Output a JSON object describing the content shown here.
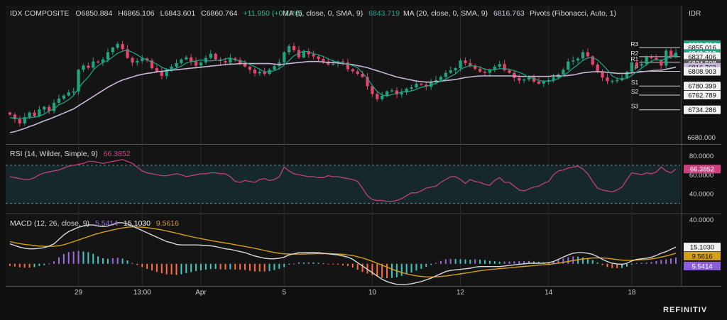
{
  "colors": {
    "up": "#22a37f",
    "down": "#e4456a",
    "ma5": "#1ea68a",
    "ma20": "#c7b6d8",
    "rsi": "#c0407a",
    "signal": "#d4a017",
    "macd": "#d8d8d8",
    "hist_up": "#9b6de0",
    "hist_down": "#ff6f3c",
    "hist_teal": "#3fc9c1",
    "panel": "#131313",
    "grid": "#2a2a2a"
  },
  "brand": "REFINITIV",
  "axis_currency": "IDR",
  "chart_data": [
    {
      "type": "candlestick",
      "legend": {
        "name": "IDX COMPOSITE",
        "open_label": "O",
        "open": "6850.884",
        "high_label": "H",
        "high": "6865.106",
        "low_label": "L",
        "low": "6843.601",
        "close_label": "C",
        "close": "6860.764",
        "change": "+11.950 (+0.17%)",
        "ma5_label": "MA (5, close, 0, SMA, 9)",
        "ma5_value": "6843.719",
        "ma20_label": "MA (20, close, 0, SMA, 9)",
        "ma20_value": "6816.763",
        "pivots_label": "Pivots (Fibonacci, Auto, 1)"
      },
      "y_range": [
        6672,
        6906
      ],
      "x_ticks": [
        {
          "i": 14,
          "label": "29"
        },
        {
          "i": 27,
          "label": "13:00"
        },
        {
          "i": 39,
          "label": "Apr"
        },
        {
          "i": 56,
          "label": "5"
        },
        {
          "i": 74,
          "label": "10"
        },
        {
          "i": 92,
          "label": "12"
        },
        {
          "i": 110,
          "label": "14"
        },
        {
          "i": 127,
          "label": "18"
        }
      ],
      "y_tick": "6680.000",
      "price_tags": [
        {
          "value": 6860.764,
          "label": "6860.764",
          "kind": "last"
        },
        {
          "value": 6855.016,
          "label": "6855.016",
          "kind": "plain"
        },
        {
          "value": 6843.719,
          "label": "6843.719",
          "kind": "ma5"
        },
        {
          "value": 6837.406,
          "label": "6837.406",
          "kind": "plain"
        },
        {
          "value": 6824.508,
          "label": "6824.508",
          "kind": "grey"
        },
        {
          "value": 6816.763,
          "label": "6816.763",
          "kind": "ma20"
        },
        {
          "value": 6808.903,
          "label": "6808.903",
          "kind": "plain"
        },
        {
          "value": 6780.399,
          "label": "6780.399",
          "kind": "plain"
        },
        {
          "value": 6762.789,
          "label": "6762.789",
          "kind": "plain"
        },
        {
          "value": 6734.286,
          "label": "6734.286",
          "kind": "plain"
        }
      ],
      "pivots": [
        {
          "label": "R3",
          "value": 6855.016
        },
        {
          "label": "R2",
          "value": 6837.406
        },
        {
          "label": "R1",
          "value": 6826.5
        },
        {
          "label": "P",
          "value": 6808.903
        },
        {
          "label": "S1",
          "value": 6780.399
        },
        {
          "label": "S2",
          "value": 6762.789
        },
        {
          "label": "S3",
          "value": 6734.286
        }
      ],
      "closes": [
        6725,
        6716,
        6708,
        6720,
        6729,
        6722,
        6735,
        6740,
        6732,
        6748,
        6756,
        6762,
        6768,
        6770,
        6812,
        6820,
        6816,
        6828,
        6826,
        6832,
        6846,
        6855,
        6862,
        6852,
        6835,
        6826,
        6829,
        6834,
        6830,
        6815,
        6808,
        6800,
        6812,
        6818,
        6825,
        6832,
        6836,
        6828,
        6820,
        6826,
        6835,
        6843,
        6832,
        6829,
        6826,
        6834,
        6831,
        6824,
        6818,
        6812,
        6805,
        6808,
        6804,
        6812,
        6819,
        6826,
        6846,
        6858,
        6850,
        6836,
        6848,
        6842,
        6838,
        6833,
        6828,
        6822,
        6824,
        6828,
        6826,
        6813,
        6809,
        6804,
        6798,
        6780,
        6765,
        6755,
        6762,
        6770,
        6772,
        6764,
        6768,
        6775,
        6778,
        6785,
        6783,
        6779,
        6788,
        6792,
        6798,
        6806,
        6811,
        6815,
        6830,
        6825,
        6820,
        6814,
        6808,
        6806,
        6812,
        6818,
        6823,
        6811,
        6806,
        6796,
        6791,
        6793,
        6797,
        6789,
        6785,
        6789,
        6792,
        6797,
        6803,
        6812,
        6828,
        6830,
        6834,
        6846,
        6838,
        6822,
        6807,
        6797,
        6790,
        6790,
        6792,
        6796,
        6808,
        6826,
        6820,
        6823,
        6837,
        6835,
        6831,
        6820,
        6849,
        6838,
        6845
      ],
      "ma5": [
        6719,
        6718,
        6717,
        6718,
        6719,
        6720,
        6722,
        6726,
        6732,
        6736,
        6744,
        6748,
        6754,
        6762,
        6776,
        6788,
        6798,
        6811,
        6820,
        6826,
        6830,
        6837,
        6844,
        6848,
        6850,
        6846,
        6841,
        6835,
        6831,
        6827,
        6823,
        6817,
        6813,
        6812,
        6815,
        6819,
        6825,
        6828,
        6829,
        6831,
        6830,
        6829,
        6830,
        6830,
        6833,
        6835,
        6831,
        6829,
        6827,
        6822,
        6818,
        6813,
        6808,
        6808,
        6810,
        6814,
        6821,
        6830,
        6839,
        6844,
        6848,
        6847,
        6843,
        6841,
        6838,
        6833,
        6829,
        6827,
        6825,
        6823,
        6820,
        6816,
        6806,
        6795,
        6781,
        6770,
        6763,
        6761,
        6764,
        6766,
        6769,
        6770,
        6771,
        6774,
        6778,
        6780,
        6782,
        6786,
        6790,
        6794,
        6799,
        6804,
        6813,
        6817,
        6820,
        6819,
        6817,
        6813,
        6812,
        6812,
        6814,
        6814,
        6813,
        6810,
        6807,
        6803,
        6797,
        6795,
        6791,
        6790,
        6790,
        6791,
        6795,
        6801,
        6807,
        6815,
        6822,
        6830,
        6835,
        6836,
        6831,
        6822,
        6812,
        6800,
        6795,
        6794,
        6795,
        6801,
        6808,
        6815,
        6822,
        6829,
        6832,
        6830,
        6834,
        6836,
        6844
      ],
      "ma20": [
        6690,
        6692,
        6695,
        6698,
        6702,
        6705,
        6709,
        6713,
        6716,
        6720,
        6724,
        6728,
        6732,
        6736,
        6742,
        6748,
        6754,
        6760,
        6766,
        6772,
        6778,
        6783,
        6788,
        6792,
        6795,
        6798,
        6801,
        6803,
        6805,
        6806,
        6808,
        6809,
        6810,
        6811,
        6812,
        6813,
        6814,
        6815,
        6816,
        6817,
        6818,
        6819,
        6820,
        6821,
        6822,
        6823,
        6823,
        6824,
        6824,
        6824,
        6824,
        6824,
        6824,
        6824,
        6823,
        6822,
        6823,
        6824,
        6825,
        6826,
        6827,
        6828,
        6828,
        6828,
        6827,
        6826,
        6826,
        6825,
        6824,
        6823,
        6822,
        6820,
        6818,
        6816,
        6813,
        6810,
        6807,
        6804,
        6801,
        6798,
        6796,
        6794,
        6792,
        6790,
        6789,
        6788,
        6788,
        6789,
        6790,
        6791,
        6792,
        6793,
        6795,
        6797,
        6798,
        6799,
        6800,
        6800,
        6800,
        6800,
        6800,
        6800,
        6800,
        6800,
        6799,
        6799,
        6799,
        6799,
        6799,
        6799,
        6799,
        6800,
        6800,
        6800,
        6801,
        6802,
        6804,
        6806,
        6807,
        6808,
        6808,
        6808,
        6807,
        6806,
        6805,
        6805,
        6805,
        6806,
        6807,
        6808,
        6809,
        6810,
        6811,
        6811,
        6813,
        6815,
        6817
      ]
    },
    {
      "type": "line",
      "name": "rsi",
      "legend": {
        "label": "RSI (14, Wilder, Simple, 9)",
        "value": "66.3852"
      },
      "y_range": [
        20,
        90
      ],
      "ticks": [
        {
          "value": 80,
          "label": "80.0000"
        },
        {
          "value": 60,
          "label": "60.0000"
        },
        {
          "value": 40,
          "label": "40.0000"
        }
      ],
      "band": [
        30,
        70
      ],
      "last_tag": "66.3852",
      "values": [
        58,
        57,
        56,
        55,
        55,
        57,
        60,
        62,
        63,
        64,
        65,
        67,
        69,
        70,
        71,
        72,
        74,
        74,
        73,
        72,
        73,
        74,
        75,
        76,
        74,
        72,
        68,
        64,
        62,
        61,
        60,
        59,
        59,
        60,
        61,
        60,
        58,
        59,
        60,
        61,
        61,
        62,
        62,
        61,
        61,
        58,
        53,
        52,
        54,
        53,
        52,
        55,
        56,
        54,
        55,
        58,
        68,
        64,
        61,
        60,
        59,
        58,
        58,
        57,
        57,
        59,
        58,
        58,
        57,
        56,
        55,
        53,
        46,
        38,
        34,
        33,
        33,
        32,
        32,
        33,
        35,
        38,
        41,
        41,
        43,
        46,
        47,
        48,
        52,
        55,
        58,
        58,
        55,
        51,
        55,
        53,
        52,
        50,
        49,
        54,
        57,
        52,
        52,
        48,
        44,
        43,
        45,
        47,
        48,
        51,
        53,
        60,
        64,
        65,
        67,
        68,
        69,
        66,
        61,
        53,
        46,
        44,
        43,
        42,
        44,
        47,
        55,
        62,
        61,
        60,
        62,
        61,
        63,
        68,
        64,
        62,
        66
      ]
    },
    {
      "type": "line",
      "name": "macd",
      "legend": {
        "label": "MACD (12, 26, close, 9)",
        "hist": "5.5414",
        "macd": "15.1030",
        "signal": "9.5616"
      },
      "y_range": [
        -20,
        44
      ],
      "ticks": [
        {
          "value": 40,
          "label": "40.0000"
        },
        {
          "value": 0,
          "label": "0.0000"
        }
      ],
      "tags": [
        {
          "label": "15.1030",
          "kind": "macd"
        },
        {
          "label": "9.5616",
          "kind": "signal"
        },
        {
          "label": "5.5414",
          "kind": "hist"
        }
      ],
      "macd": [
        18,
        16.5,
        15,
        14,
        13.5,
        13.5,
        14,
        14.5,
        16,
        18,
        22,
        26,
        29,
        31,
        33,
        34,
        35,
        35,
        34,
        33.5,
        34,
        35.5,
        37,
        37,
        36,
        34,
        32,
        30,
        28,
        26,
        24,
        22,
        20,
        19,
        17.5,
        17,
        17,
        17,
        17,
        16.8,
        16.5,
        16.2,
        15.5,
        14.5,
        13.5,
        13,
        12,
        11,
        10,
        8.5,
        7,
        6,
        5,
        4.5,
        4.5,
        5,
        6,
        8,
        9,
        10,
        10,
        10.2,
        10.2,
        10,
        9.5,
        9,
        8.5,
        8,
        7,
        6,
        4,
        1,
        -2,
        -5,
        -8,
        -11,
        -14,
        -16,
        -17.5,
        -18.5,
        -18.8,
        -18.5,
        -18,
        -17,
        -16,
        -14.5,
        -13,
        -11,
        -9,
        -7,
        -6,
        -5.5,
        -5,
        -4.5,
        -4,
        -3,
        -2.5,
        -2.5,
        -2.5,
        -2.5,
        -2.5,
        -2,
        -1.5,
        -1,
        -0.5,
        0,
        0.5,
        0.5,
        0.5,
        0.5,
        1,
        2,
        4,
        6,
        8,
        9.5,
        10,
        10,
        9.5,
        8.5,
        6.5,
        4,
        2,
        0.5,
        -0.2,
        -0.5,
        0.5,
        2.5,
        4,
        4.5,
        5,
        6,
        7.5,
        9.5,
        11,
        13,
        15.1
      ],
      "signal": [
        20,
        19,
        18.2,
        17.5,
        17,
        16.5,
        16,
        15.8,
        15.7,
        15.8,
        16.3,
        17.2,
        18.5,
        20,
        21.5,
        23,
        24.5,
        26,
        27.3,
        28.5,
        29.5,
        30.5,
        31.5,
        32.3,
        33,
        33.3,
        33.2,
        33,
        32.6,
        32,
        31.3,
        30.5,
        29.6,
        28.6,
        27.6,
        26.5,
        25.5,
        24.5,
        23.5,
        22.7,
        21.8,
        21,
        20.2,
        19.5,
        18.7,
        18,
        17.2,
        16.4,
        15.6,
        14.8,
        13.9,
        13,
        12,
        11.1,
        10.2,
        9.5,
        9,
        8.8,
        8.7,
        8.7,
        8.8,
        8.9,
        9,
        9.1,
        9.1,
        9.1,
        9,
        8.8,
        8.5,
        8,
        7.3,
        6.4,
        5.2,
        3.8,
        2.2,
        0.5,
        -1.3,
        -3,
        -4.8,
        -6.4,
        -7.9,
        -9.1,
        -10.1,
        -10.9,
        -11.4,
        -11.8,
        -11.9,
        -11.8,
        -11.5,
        -11,
        -10.4,
        -9.8,
        -9.1,
        -8.4,
        -7.7,
        -7,
        -6.3,
        -5.7,
        -5.2,
        -4.8,
        -4.4,
        -4,
        -3.6,
        -3.2,
        -2.8,
        -2.4,
        -2,
        -1.6,
        -1.2,
        -0.9,
        -0.5,
        0,
        0.6,
        1.3,
        2.1,
        2.9,
        3.6,
        4.3,
        4.8,
        5.2,
        5.3,
        5.2,
        4.9,
        4.4,
        3.8,
        3.3,
        3.1,
        3.2,
        3.4,
        3.6,
        3.9,
        4.4,
        5.1,
        6,
        7,
        8.2,
        9.56
      ]
    }
  ]
}
